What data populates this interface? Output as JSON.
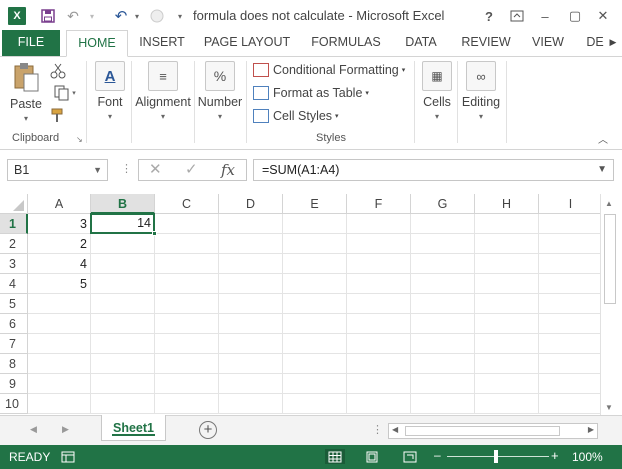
{
  "window": {
    "title": "formula does not calculate - Microsoft Excel",
    "help_label": "?",
    "minimize_label": "–",
    "restore_label": "▢",
    "close_label": "✕"
  },
  "quick_access": {
    "logo_label": "X",
    "save_icon": "save-icon",
    "undo_icon": "undo-icon",
    "redo_icon": "redo-icon"
  },
  "ribbon_tabs": [
    "FILE",
    "HOME",
    "INSERT",
    "PAGE LAYOUT",
    "FORMULAS",
    "DATA",
    "REVIEW",
    "VIEW",
    "DE"
  ],
  "ribbon": {
    "clipboard": {
      "paste_label": "Paste",
      "group_label": "Clipboard"
    },
    "font_label": "Font",
    "alignment_label": "Alignment",
    "number_label": "Number",
    "number_icon": "%",
    "styles": {
      "conditional_formatting": "Conditional Formatting",
      "format_as_table": "Format as Table",
      "cell_styles": "Cell Styles",
      "group_label": "Styles"
    },
    "cells_label": "Cells",
    "editing_label": "Editing"
  },
  "formula_bar": {
    "name_box": "B1",
    "cancel_label": "✕",
    "enter_label": "✓",
    "fx_label": "fx",
    "formula": "=SUM(A1:A4)"
  },
  "sheet": {
    "columns": [
      "A",
      "B",
      "C",
      "D",
      "E",
      "F",
      "G",
      "H",
      "I"
    ],
    "selected_column": "B",
    "rows": [
      "1",
      "2",
      "3",
      "4",
      "5",
      "6",
      "7",
      "8",
      "9",
      "10"
    ],
    "selected_row": "1",
    "active_cell": "B1",
    "cells": {
      "A1": "3",
      "B1": "14",
      "A2": "2",
      "A3": "4",
      "A4": "5"
    }
  },
  "sheet_tabs": {
    "tabs": [
      "Sheet1"
    ],
    "active": "Sheet1",
    "add_label": "+"
  },
  "status_bar": {
    "status": "READY",
    "zoom": "100%",
    "zoom_minus": "–",
    "zoom_plus": "+"
  },
  "colors": {
    "accent": "#217346"
  }
}
